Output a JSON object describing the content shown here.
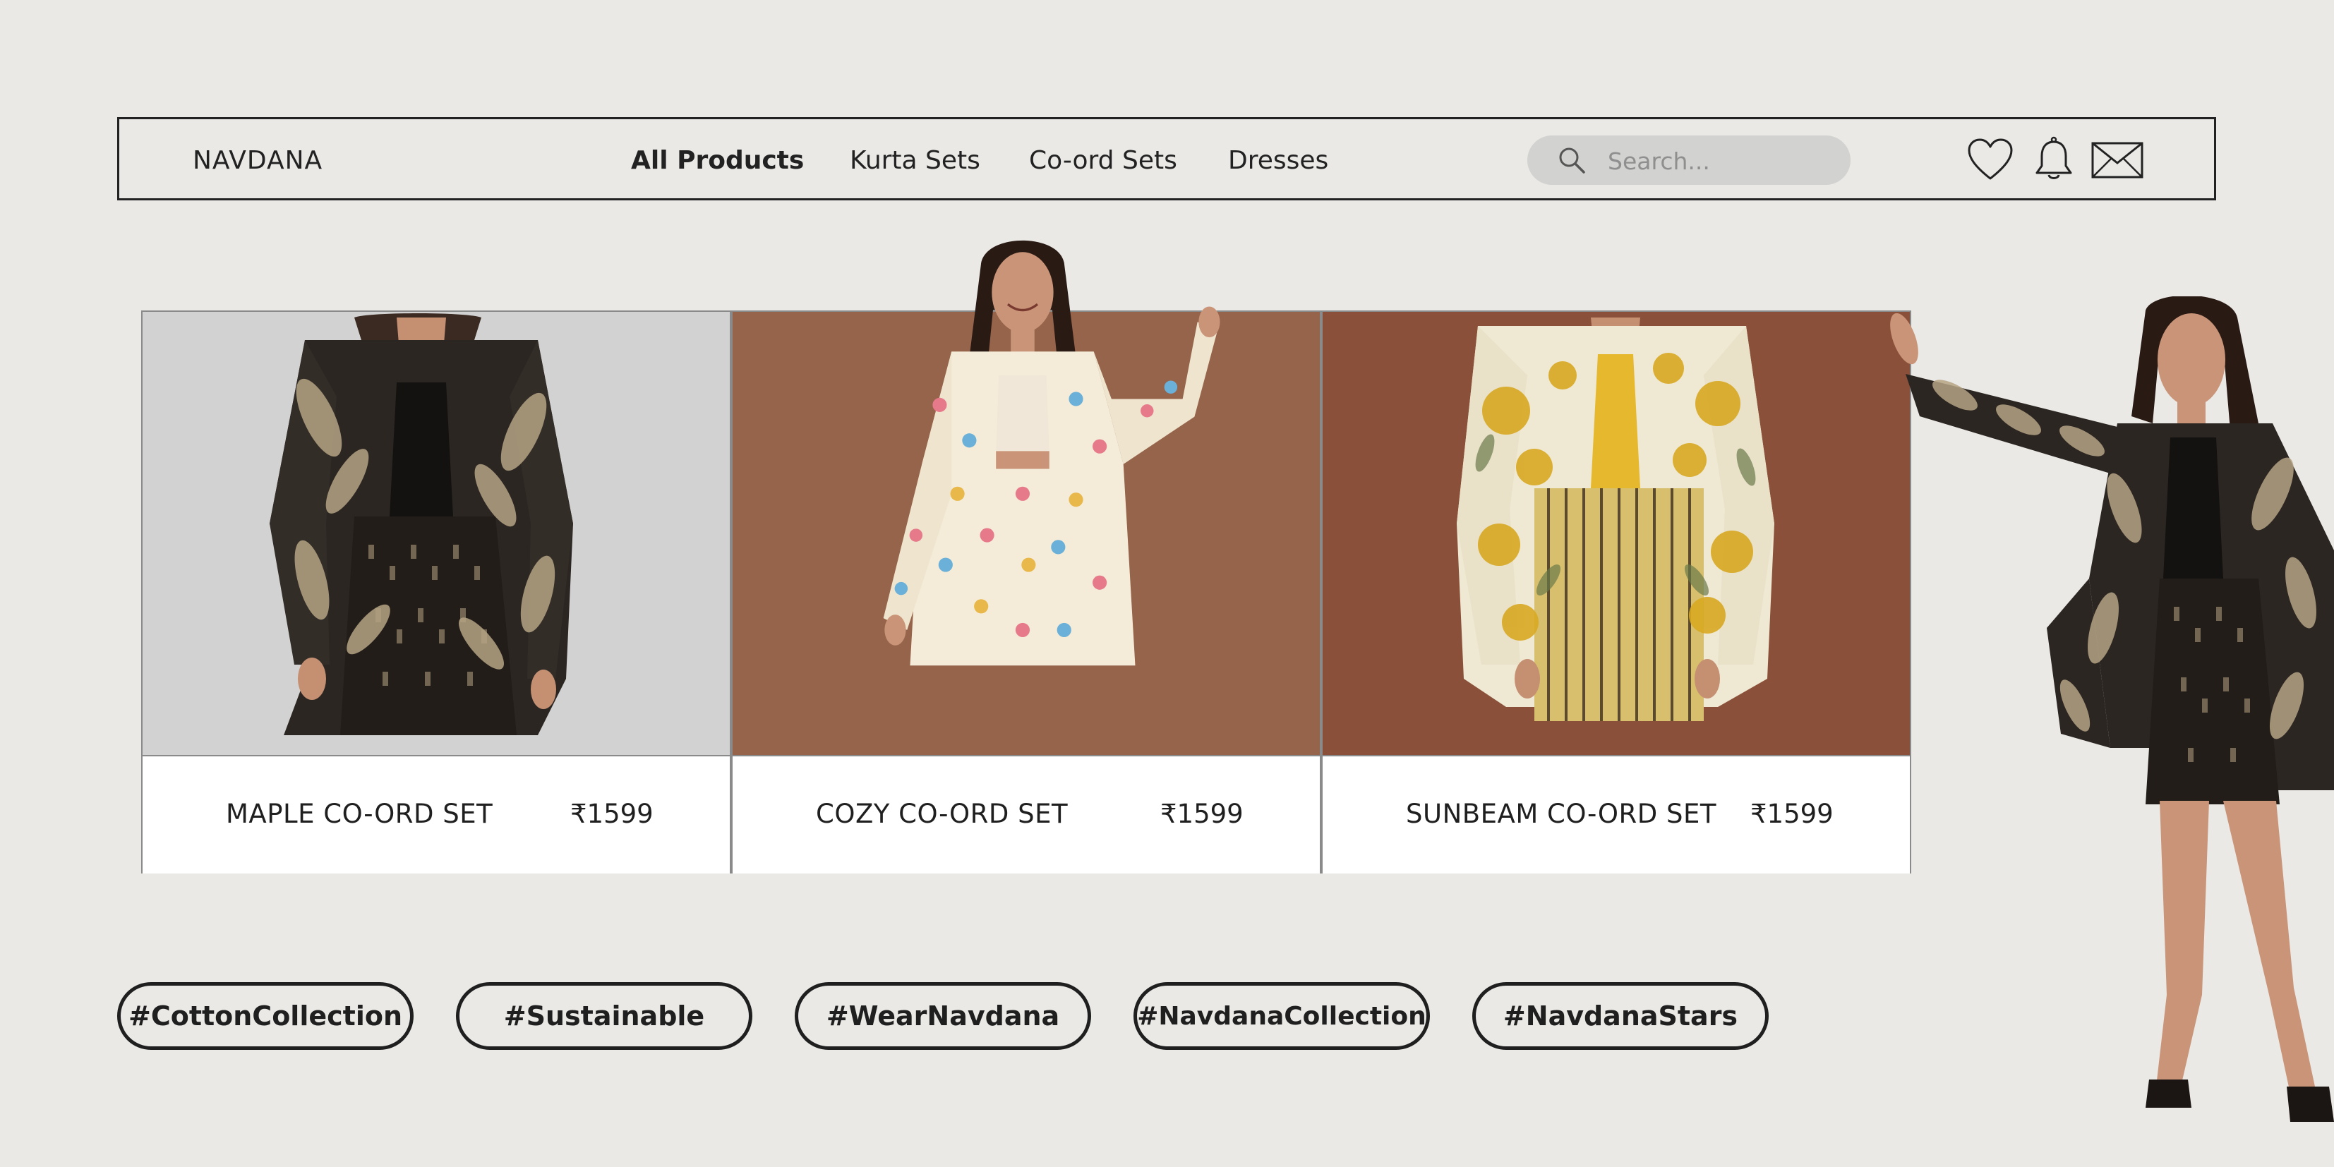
{
  "brand": "NAVDANA",
  "nav": {
    "links": [
      "All Products",
      "Kurta Sets",
      "Co-ord Sets",
      "Dresses"
    ],
    "active_index": 0
  },
  "search": {
    "placeholder": "Search..."
  },
  "header_icons": [
    "heart-icon",
    "bell-icon",
    "mail-icon"
  ],
  "products": [
    {
      "name": "MAPLE CO-ORD SET",
      "price": "₹1599",
      "bg_color": "#D3D2D3"
    },
    {
      "name": "COZY CO-ORD SET",
      "price": "₹1599",
      "bg_color": "#96634B"
    },
    {
      "name": "SUNBEAM CO-ORD SET",
      "price": "₹1599",
      "bg_color": "#8A5039"
    }
  ],
  "tags": [
    "#CottonCollection",
    "#Sustainable",
    "#WearNavdana",
    "#NavdanaCollection",
    "#NavdanaStars"
  ],
  "colors": {
    "page_bg": "#EAE9E6",
    "text": "#1F1F1F",
    "search_bg": "#D2D2D0"
  }
}
